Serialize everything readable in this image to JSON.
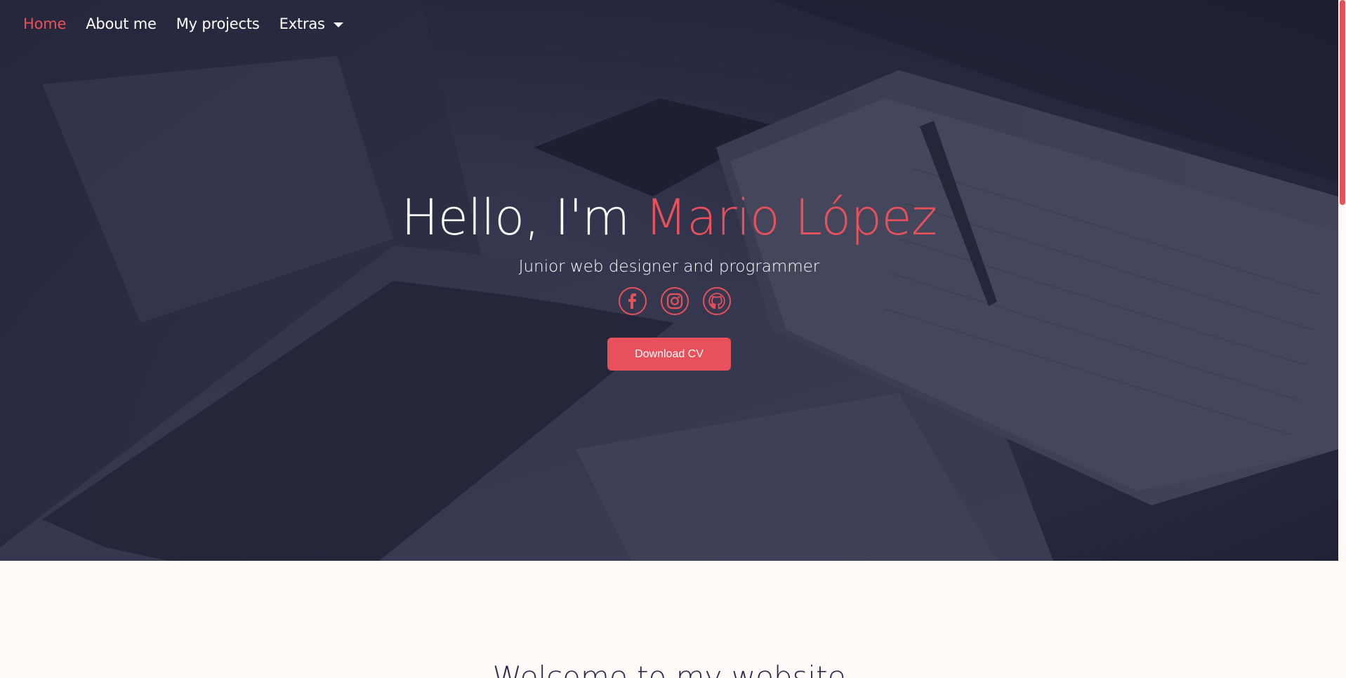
{
  "nav": {
    "items": [
      {
        "label": "Home",
        "active": true
      },
      {
        "label": "About me"
      },
      {
        "label": "My projects"
      },
      {
        "label": "Extras",
        "dropdown": true
      }
    ]
  },
  "hero": {
    "greeting": "Hello, I'm ",
    "name": "Mario López",
    "subtitle": "Junior web designer and programmer",
    "socials": [
      {
        "icon": "facebook-icon"
      },
      {
        "icon": "instagram-icon"
      },
      {
        "icon": "github-icon"
      }
    ],
    "cta_label": "Download CV"
  },
  "welcome": {
    "title": "Welcome to my website"
  },
  "colors": {
    "accent": "#e8505b",
    "hero_bg": "#2b2d43",
    "page_bg": "#fff9f8",
    "heading_dark": "#2d2b4a"
  }
}
